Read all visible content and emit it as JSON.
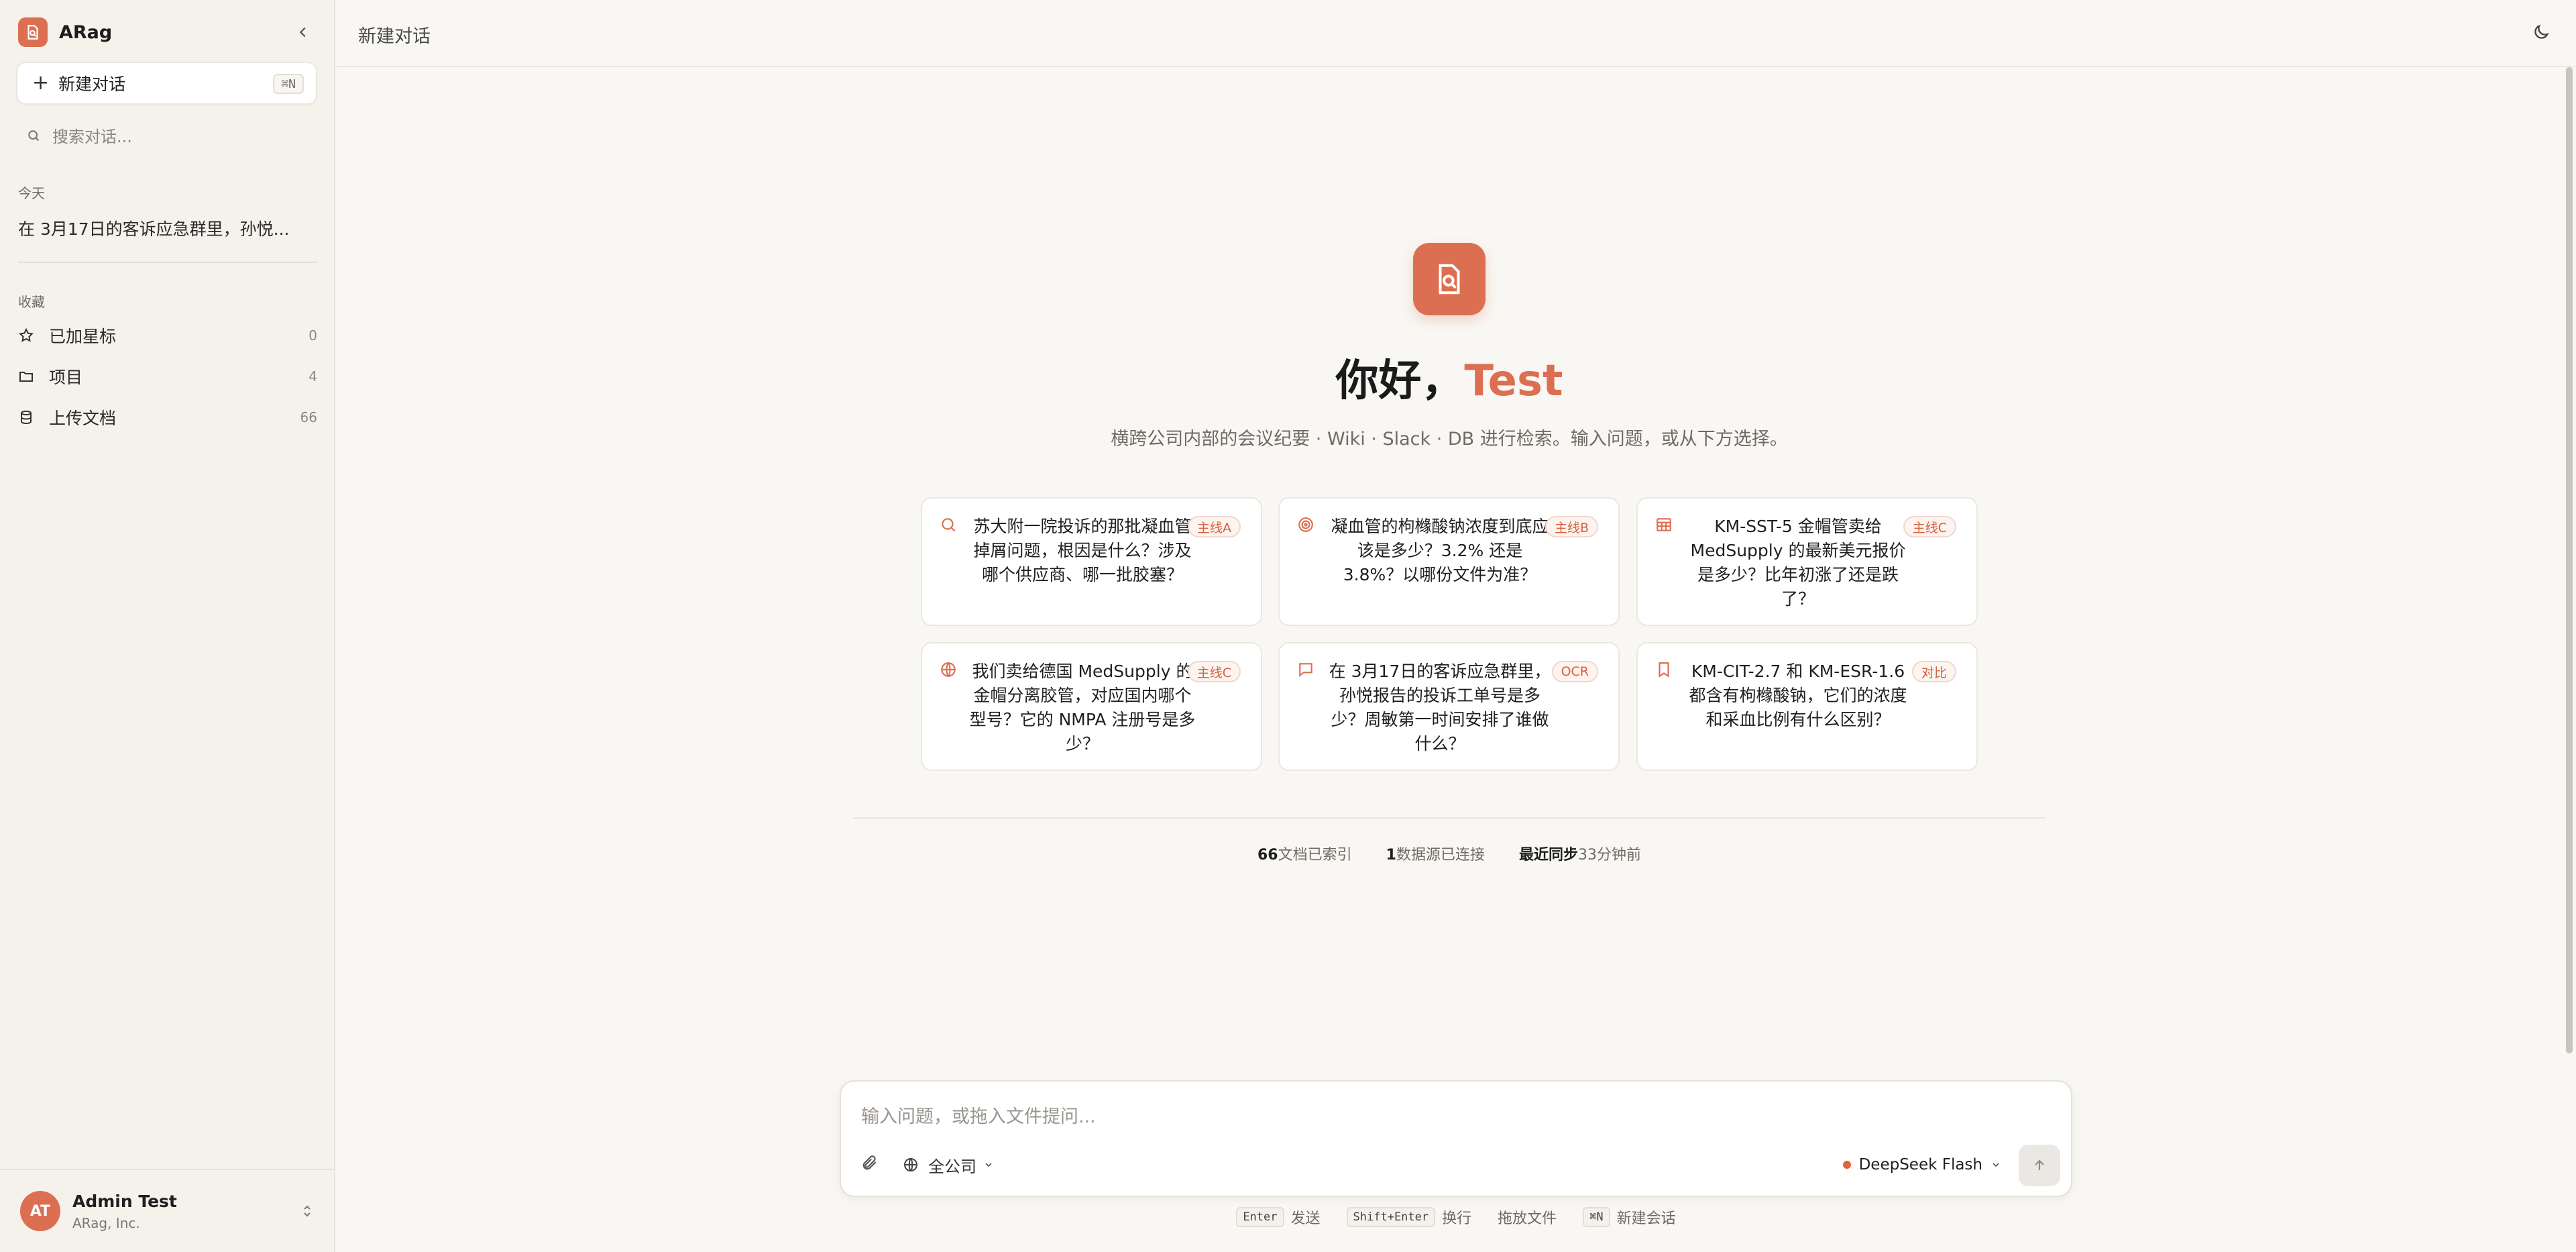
{
  "app": {
    "name": "ARag",
    "accent": "#dc6f52"
  },
  "sidebar": {
    "new_chat_label": "新建对话",
    "new_chat_shortcut": "⌘N",
    "search_placeholder": "搜索对话...",
    "today_label": "今天",
    "conversations": [
      {
        "title": "在 3月17日的客诉应急群里，孙悦..."
      }
    ],
    "favorites_label": "收藏",
    "favorites": [
      {
        "label": "已加星标",
        "count": "0",
        "icon": "star-icon"
      },
      {
        "label": "项目",
        "count": "4",
        "icon": "folder-icon"
      },
      {
        "label": "上传文档",
        "count": "66",
        "icon": "database-icon"
      }
    ]
  },
  "user": {
    "initials": "AT",
    "name": "Admin Test",
    "org": "ARag, Inc."
  },
  "header": {
    "title": "新建对话"
  },
  "hero": {
    "greeting": "你好，",
    "name": "Test",
    "subtitle": "横跨公司内部的会议纪要 · Wiki · Slack · DB 进行检索。输入问题，或从下方选择。"
  },
  "suggestions": [
    {
      "icon": "search-icon",
      "text": "苏大附一院投诉的那批凝血管掉屑问题，根因是什么？涉及哪个供应商、哪一批胶塞？",
      "tag": "主线A"
    },
    {
      "icon": "target-icon",
      "text": "凝血管的枸橼酸钠浓度到底应该是多少？3.2% 还是 3.8%？以哪份文件为准？",
      "tag": "主线B"
    },
    {
      "icon": "table-icon",
      "text": "KM-SST-5 金帽管卖给 MedSupply 的最新美元报价是多少？比年初涨了还是跌了？",
      "tag": "主线C"
    },
    {
      "icon": "globe-icon",
      "text": "我们卖给德国 MedSupply 的金帽分离胶管，对应国内哪个型号？它的 NMPA 注册号是多少？",
      "tag": "主线C"
    },
    {
      "icon": "message-icon",
      "text": "在 3月17日的客诉应急群里，孙悦报告的投诉工单号是多少？周敏第一时间安排了谁做什么？",
      "tag": "OCR"
    },
    {
      "icon": "bookmark-icon",
      "text": "KM-CIT-2.7 和 KM-ESR-1.6 都含有枸橼酸钠，它们的浓度和采血比例有什么区别？",
      "tag": "对比"
    }
  ],
  "stats": [
    {
      "value": "66",
      "label": "文档已索引"
    },
    {
      "value": "1",
      "label": "数据源已连接"
    },
    {
      "value": "最近同步",
      "label": "33分钟前"
    }
  ],
  "composer": {
    "placeholder": "输入问题，或拖入文件提问...",
    "scope": "全公司",
    "model": "DeepSeek Flash"
  },
  "hints": [
    {
      "key": "Enter",
      "text": "发送"
    },
    {
      "key": "Shift+Enter",
      "text": "换行"
    },
    {
      "key": "",
      "text": "拖放文件"
    },
    {
      "key": "⌘N",
      "text": "新建会话"
    }
  ]
}
